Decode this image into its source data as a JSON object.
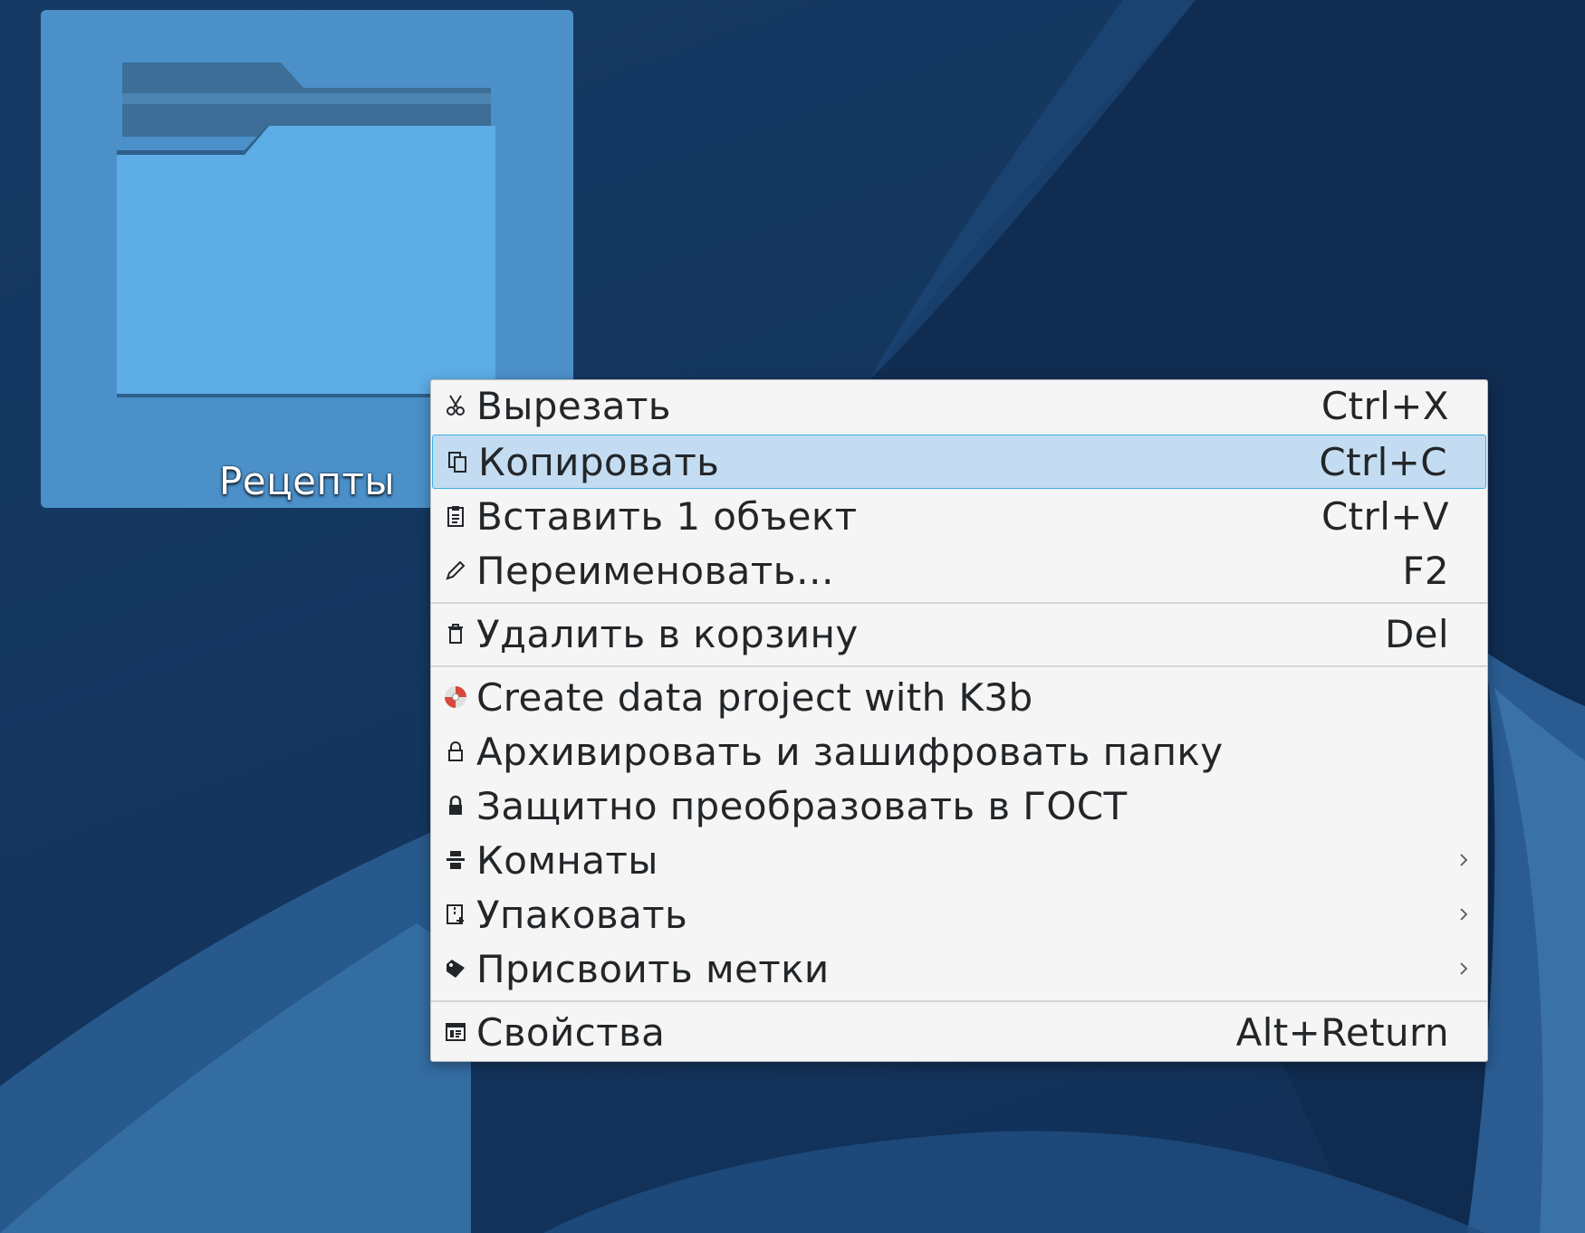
{
  "desktop": {
    "folder": {
      "label": "Рецепты",
      "icon": "folder-icon"
    }
  },
  "context_menu": {
    "items": [
      {
        "id": "cut",
        "icon": "scissors-icon",
        "label": "Вырезать",
        "shortcut": "Ctrl+X"
      },
      {
        "id": "copy",
        "icon": "copy-icon",
        "label": "Копировать",
        "shortcut": "Ctrl+C",
        "highlighted": true
      },
      {
        "id": "paste",
        "icon": "clipboard-icon",
        "label": "Вставить 1 объект",
        "shortcut": "Ctrl+V"
      },
      {
        "id": "rename",
        "icon": "pencil-icon",
        "label": "Переименовать…",
        "shortcut": "F2"
      },
      {
        "id": "trash",
        "icon": "trash-icon",
        "label": "Удалить в корзину",
        "shortcut": "Del"
      },
      {
        "id": "k3b",
        "icon": "k3b-icon",
        "label": "Create data project with K3b"
      },
      {
        "id": "archive-encrypt",
        "icon": "lock-outline-icon",
        "label": "Архивировать и зашифровать папку"
      },
      {
        "id": "gost",
        "icon": "lock-filled-icon",
        "label": "Защитно преобразовать в ГОСТ"
      },
      {
        "id": "activities",
        "icon": "activities-icon",
        "label": "Комнаты",
        "submenu": true
      },
      {
        "id": "compress",
        "icon": "archive-icon",
        "label": "Упаковать",
        "submenu": true
      },
      {
        "id": "tags",
        "icon": "tag-icon",
        "label": "Присвоить метки",
        "submenu": true
      },
      {
        "id": "properties",
        "icon": "properties-icon",
        "label": "Свойства",
        "shortcut": "Alt+Return"
      }
    ]
  },
  "colors": {
    "wallpaper": "#14365f",
    "folder_selection": "#4b90c9",
    "menu_background": "#f5f5f5",
    "highlight": "#c3dcf1",
    "highlight_border": "#3daee9",
    "text": "#232629"
  }
}
